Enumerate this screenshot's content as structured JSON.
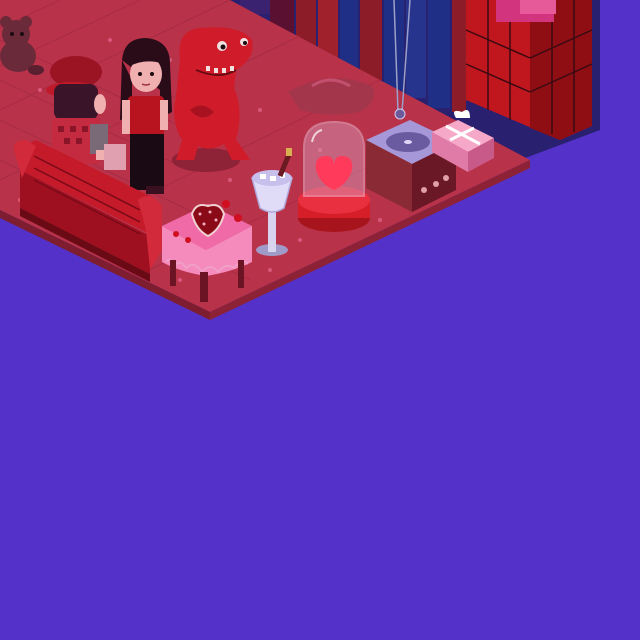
{
  "scene": {
    "background_color": "#5431c8",
    "floor_color": "#b8324a",
    "floor_edge_color": "#7e1d30",
    "tile_dot_color": "#d9587a",
    "wall_colors": [
      "#8c1c28",
      "#1f2f86",
      "#b6141c",
      "#3a2270"
    ]
  },
  "room_items": [
    {
      "name": "teddy-bear",
      "icon": "teddy-bear-icon"
    },
    {
      "name": "avatar-boy-red-cap",
      "icon": "avatar-icon"
    },
    {
      "name": "avatar-girl-dark-hair",
      "icon": "avatar-icon"
    },
    {
      "name": "red-dinosaur-statue",
      "icon": "dinosaur-icon"
    },
    {
      "name": "red-loveseat-sofa",
      "icon": "sofa-icon"
    },
    {
      "name": "heart-cake-table",
      "icon": "heart-cake-icon"
    },
    {
      "name": "champagne-bucket",
      "icon": "champagne-icon"
    },
    {
      "name": "heart-glass-dome",
      "icon": "heart-dome-icon"
    },
    {
      "name": "record-player",
      "icon": "record-player-icon"
    },
    {
      "name": "pink-gift-box",
      "icon": "gift-icon"
    },
    {
      "name": "heart-pendant-necklace",
      "icon": "pendant-icon"
    },
    {
      "name": "dinosaur-rug",
      "icon": "rug-icon"
    },
    {
      "name": "gift-box-tower",
      "icon": "gift-tower-icon"
    }
  ]
}
